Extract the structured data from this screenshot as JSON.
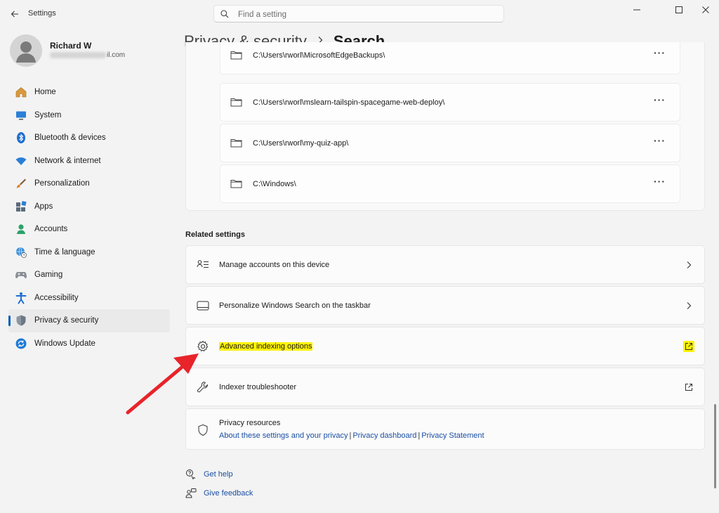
{
  "app": {
    "title": "Settings"
  },
  "search": {
    "placeholder": "Find a setting"
  },
  "user": {
    "name": "Richard W",
    "email_visible": "il.com"
  },
  "nav": {
    "items": [
      {
        "label": "Home",
        "icon": "home-icon"
      },
      {
        "label": "System",
        "icon": "monitor-icon"
      },
      {
        "label": "Bluetooth & devices",
        "icon": "bluetooth-icon"
      },
      {
        "label": "Network & internet",
        "icon": "wifi-icon"
      },
      {
        "label": "Personalization",
        "icon": "brush-icon"
      },
      {
        "label": "Apps",
        "icon": "apps-icon"
      },
      {
        "label": "Accounts",
        "icon": "person-icon"
      },
      {
        "label": "Time & language",
        "icon": "globe-clock-icon"
      },
      {
        "label": "Gaming",
        "icon": "gamepad-icon"
      },
      {
        "label": "Accessibility",
        "icon": "accessibility-icon"
      },
      {
        "label": "Privacy & security",
        "icon": "shield-icon"
      },
      {
        "label": "Windows Update",
        "icon": "update-icon"
      }
    ],
    "selected": "Privacy & security"
  },
  "breadcrumb": {
    "parent": "Privacy & security",
    "current": "Search"
  },
  "folders": [
    "C:\\Users\\rworl\\MicrosoftEdgeBackups\\",
    "C:\\Users\\rworl\\mslearn-tailspin-spacegame-web-deploy\\",
    "C:\\Users\\rworl\\my-quiz-app\\",
    "C:\\Windows\\"
  ],
  "more_glyph": "···",
  "related": {
    "title": "Related settings",
    "items": [
      {
        "label": "Manage accounts on this device",
        "icon": "manage-accounts-icon",
        "action": "chevron"
      },
      {
        "label": "Personalize Windows Search on the taskbar",
        "icon": "taskbar-icon",
        "action": "chevron"
      },
      {
        "label": "Advanced indexing options",
        "icon": "gear-icon",
        "action": "external"
      },
      {
        "label": "Indexer troubleshooter",
        "icon": "wrench-icon",
        "action": "external"
      }
    ]
  },
  "privacy_resources": {
    "title": "Privacy resources",
    "links": [
      "About these settings and your privacy",
      "Privacy dashboard",
      "Privacy Statement"
    ],
    "separator": "|"
  },
  "footer": {
    "help": "Get help",
    "feedback": "Give feedback"
  },
  "colors": {
    "accent": "#005fb8",
    "highlight": "#fff200",
    "annotation_arrow": "#e8232a",
    "link": "#1a4fa3"
  }
}
